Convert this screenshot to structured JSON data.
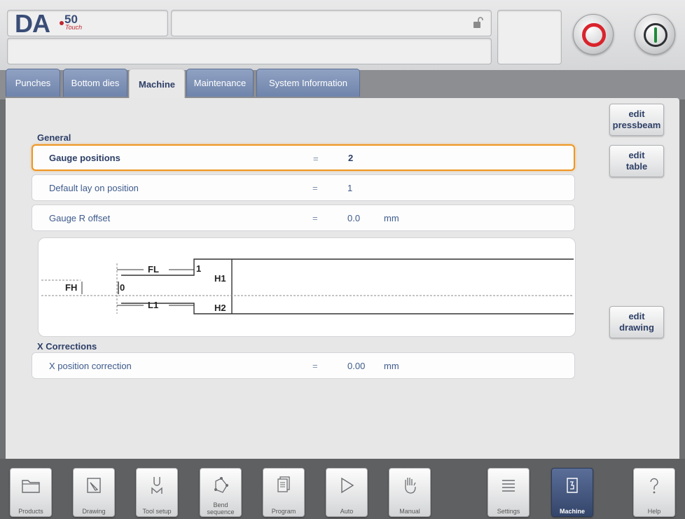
{
  "header": {
    "logo_main": "DA",
    "logo_number": "50",
    "logo_sub": "Touch"
  },
  "tabs": [
    {
      "label": "Punches"
    },
    {
      "label": "Bottom dies"
    },
    {
      "label": "Machine"
    },
    {
      "label": "Maintenance"
    },
    {
      "label": "System Information"
    }
  ],
  "general": {
    "section_label": "General",
    "params": [
      {
        "name": "Gauge positions",
        "eq": "=",
        "value": "2",
        "unit": ""
      },
      {
        "name": "Default lay on position",
        "eq": "=",
        "value": "1",
        "unit": ""
      },
      {
        "name": "Gauge R offset",
        "eq": "=",
        "value": "0.0",
        "unit": "mm"
      }
    ]
  },
  "drawing": {
    "labels": {
      "fl": "FL",
      "one": "1",
      "h1": "H1",
      "fh": "FH",
      "zero": "0",
      "l1": "L1",
      "h2": "H2"
    }
  },
  "x_corrections": {
    "section_label": "X Corrections",
    "params": [
      {
        "name": "X position correction",
        "eq": "=",
        "value": "0.00",
        "unit": "mm"
      }
    ]
  },
  "side_buttons": {
    "edit_pressbeam": {
      "line1": "edit",
      "line2": "pressbeam"
    },
    "edit_table": {
      "line1": "edit",
      "line2": "table"
    },
    "edit_drawing": {
      "line1": "edit",
      "line2": "drawing"
    }
  },
  "bottom_nav": [
    {
      "label": "Products",
      "icon": "folder-icon"
    },
    {
      "label": "Drawing",
      "icon": "pencil-icon"
    },
    {
      "label": "Tool setup",
      "icon": "tool-icon"
    },
    {
      "label_line1": "Bend",
      "label_line2": "sequence",
      "icon": "bend-sequence-icon"
    },
    {
      "label": "Program",
      "icon": "pages-icon"
    },
    {
      "label": "Auto",
      "icon": "play-icon"
    },
    {
      "label": "Manual",
      "icon": "hand-icon"
    },
    {
      "label": "Settings",
      "icon": "list-icon"
    },
    {
      "label": "Machine",
      "icon": "machine-icon"
    },
    {
      "label": "Help",
      "icon": "question-icon"
    }
  ],
  "colors": {
    "accent_selected": "#ef9620",
    "stop": "#d9242c",
    "start": "#1f8a3a",
    "brand": "#3a4d77"
  }
}
